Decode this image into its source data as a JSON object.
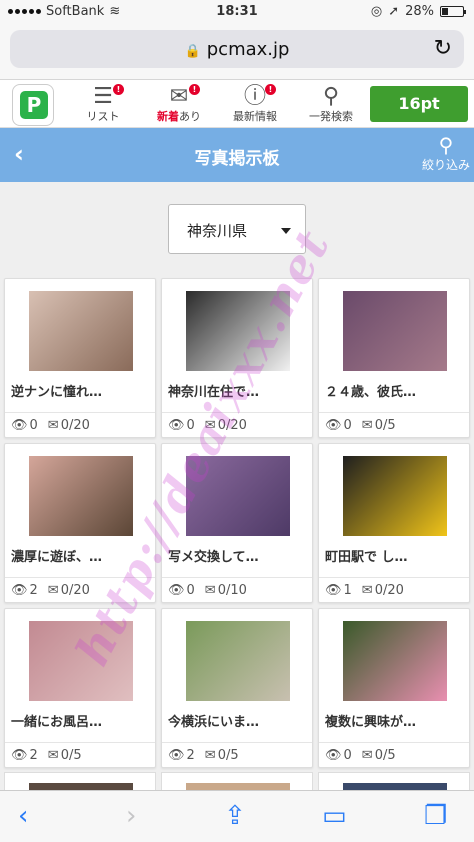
{
  "status": {
    "carrier": "SoftBank",
    "time": "18:31",
    "battery": "28%",
    "battery_level": 0.28
  },
  "browser": {
    "url": "pcmax.jp"
  },
  "nav": {
    "items": [
      {
        "label": "リスト",
        "icon": "list-icon"
      },
      {
        "label_red": "新着",
        "label_rest": "あり",
        "icon": "mail-icon"
      },
      {
        "label": "最新情報",
        "icon": "info-icon"
      },
      {
        "label": "一発検索",
        "icon": "search-icon"
      }
    ],
    "points": "16pt"
  },
  "header": {
    "title": "写真掲示板",
    "filter_label": "絞り込み"
  },
  "filter": {
    "prefecture": "神奈川県"
  },
  "posts": [
    {
      "title": "逆ナンに憧れ…",
      "views": "0",
      "messages": "0/20",
      "colors": [
        "#d8c0b3",
        "#8a6b5a"
      ]
    },
    {
      "title": "神奈川在住で…",
      "views": "0",
      "messages": "0/20",
      "colors": [
        "#2b2b2b",
        "#f1f1f1"
      ]
    },
    {
      "title": "２４歳、彼氏…",
      "views": "0",
      "messages": "0/5",
      "colors": [
        "#6a4a6a",
        "#a57a8a"
      ]
    },
    {
      "title": "濃厚に遊ぼ、…",
      "views": "2",
      "messages": "0/20",
      "colors": [
        "#d4a69a",
        "#5b4636"
      ]
    },
    {
      "title": "写メ交換して…",
      "views": "0",
      "messages": "0/10",
      "colors": [
        "#8b6a9e",
        "#4e3a66"
      ]
    },
    {
      "title": "町田駅で し…",
      "views": "1",
      "messages": "0/20",
      "colors": [
        "#1f1f1f",
        "#f0c419"
      ]
    },
    {
      "title": "一緒にお風呂…",
      "views": "2",
      "messages": "0/5",
      "colors": [
        "#c28a92",
        "#e0bfc0"
      ]
    },
    {
      "title": "今横浜にいま…",
      "views": "2",
      "messages": "0/5",
      "colors": [
        "#7a9a5a",
        "#c8c0b0"
      ]
    },
    {
      "title": "複数に興味が…",
      "views": "0",
      "messages": "0/5",
      "colors": [
        "#3a5a2a",
        "#e88fb0"
      ]
    }
  ],
  "watermark": "http://deaixxx.net"
}
